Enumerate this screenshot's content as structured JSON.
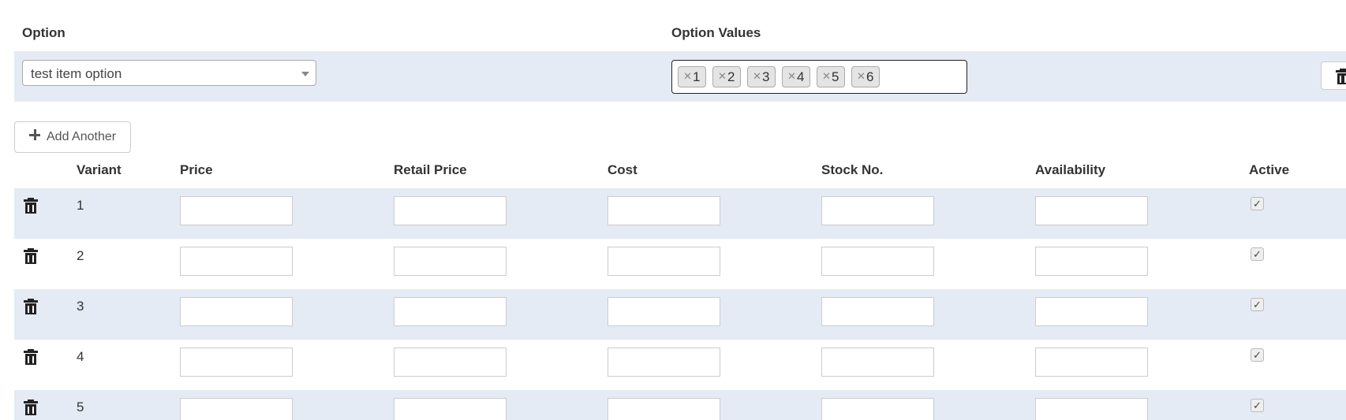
{
  "option_section": {
    "option_header": "Option",
    "option_values_header": "Option Values",
    "selected_option": "test item option",
    "option_values": [
      "1",
      "2",
      "3",
      "4",
      "5",
      "6"
    ]
  },
  "add_button_label": "Add Another",
  "table": {
    "columns": [
      "Variant",
      "Price",
      "Retail Price",
      "Cost",
      "Stock No.",
      "Availability",
      "Active"
    ],
    "rows": [
      {
        "variant": "1",
        "active": true
      },
      {
        "variant": "2",
        "active": true
      },
      {
        "variant": "3",
        "active": true
      },
      {
        "variant": "4",
        "active": true
      },
      {
        "variant": "5",
        "active": true
      }
    ]
  },
  "icons": {
    "delete": "trash-icon",
    "add": "plus-icon",
    "remove_tag": "close-icon",
    "dropdown": "chevron-down-icon",
    "check": "checkmark-icon"
  },
  "colors": {
    "row_stripe": "#e4ebf4",
    "tag_bg": "#e4e4e4"
  }
}
